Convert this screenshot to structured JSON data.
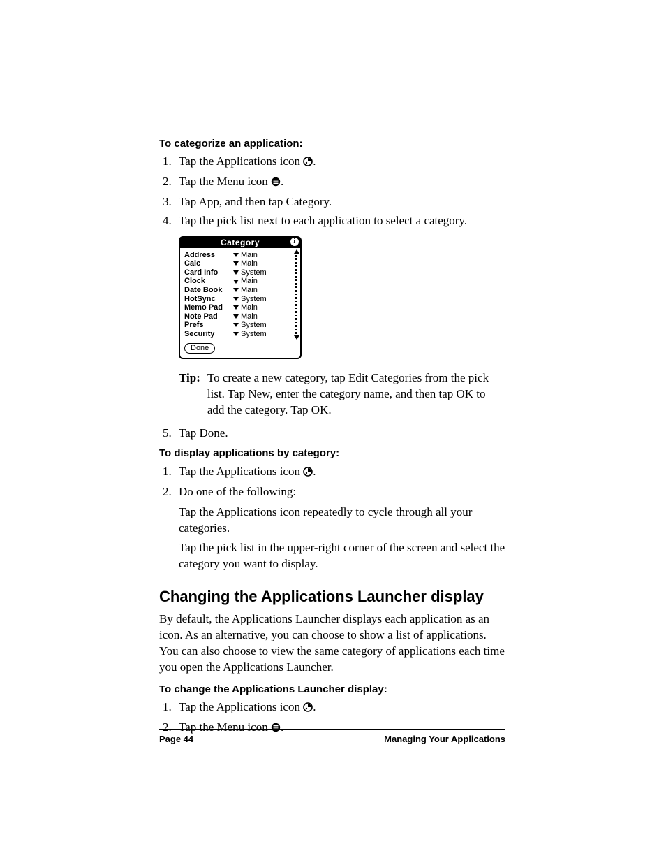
{
  "section1": {
    "heading": "To categorize an application:",
    "steps": [
      "Tap the Applications icon",
      "Tap the Menu icon",
      "Tap App, and then tap Category.",
      "Tap the pick list next to each application to select a category.",
      "Tap Done."
    ],
    "period": "."
  },
  "palm": {
    "title": "Category",
    "info": "i",
    "rows": [
      {
        "name": "Address",
        "cat": "Main"
      },
      {
        "name": "Calc",
        "cat": "Main"
      },
      {
        "name": "Card Info",
        "cat": "System"
      },
      {
        "name": "Clock",
        "cat": "Main"
      },
      {
        "name": "Date Book",
        "cat": "Main"
      },
      {
        "name": "HotSync",
        "cat": "System"
      },
      {
        "name": "Memo Pad",
        "cat": "Main"
      },
      {
        "name": "Note Pad",
        "cat": "Main"
      },
      {
        "name": "Prefs",
        "cat": "System"
      },
      {
        "name": "Security",
        "cat": "System"
      }
    ],
    "done": "Done"
  },
  "tip": {
    "label": "Tip:",
    "body": "To create a new category, tap Edit Categories from the pick list. Tap New, enter the category name, and then tap OK to add the category. Tap OK."
  },
  "section2": {
    "heading": "To display applications by category:",
    "steps": [
      "Tap the Applications icon",
      "Do one of the following:"
    ],
    "sub1": "Tap the Applications icon repeatedly to cycle through all your categories.",
    "sub2": "Tap the pick list in the upper-right corner of the screen and select the category you want to display."
  },
  "section3": {
    "heading": "Changing the Applications Launcher display",
    "body": "By default, the Applications Launcher displays each application as an icon. As an alternative, you can choose to show a list of applications. You can also choose to view the same category of applications each time you open the Applications Launcher.",
    "subheading": "To change the Applications Launcher display:",
    "steps": [
      "Tap the Applications icon",
      "Tap the Menu icon"
    ]
  },
  "footer": {
    "left": "Page 44",
    "right": "Managing Your Applications"
  }
}
